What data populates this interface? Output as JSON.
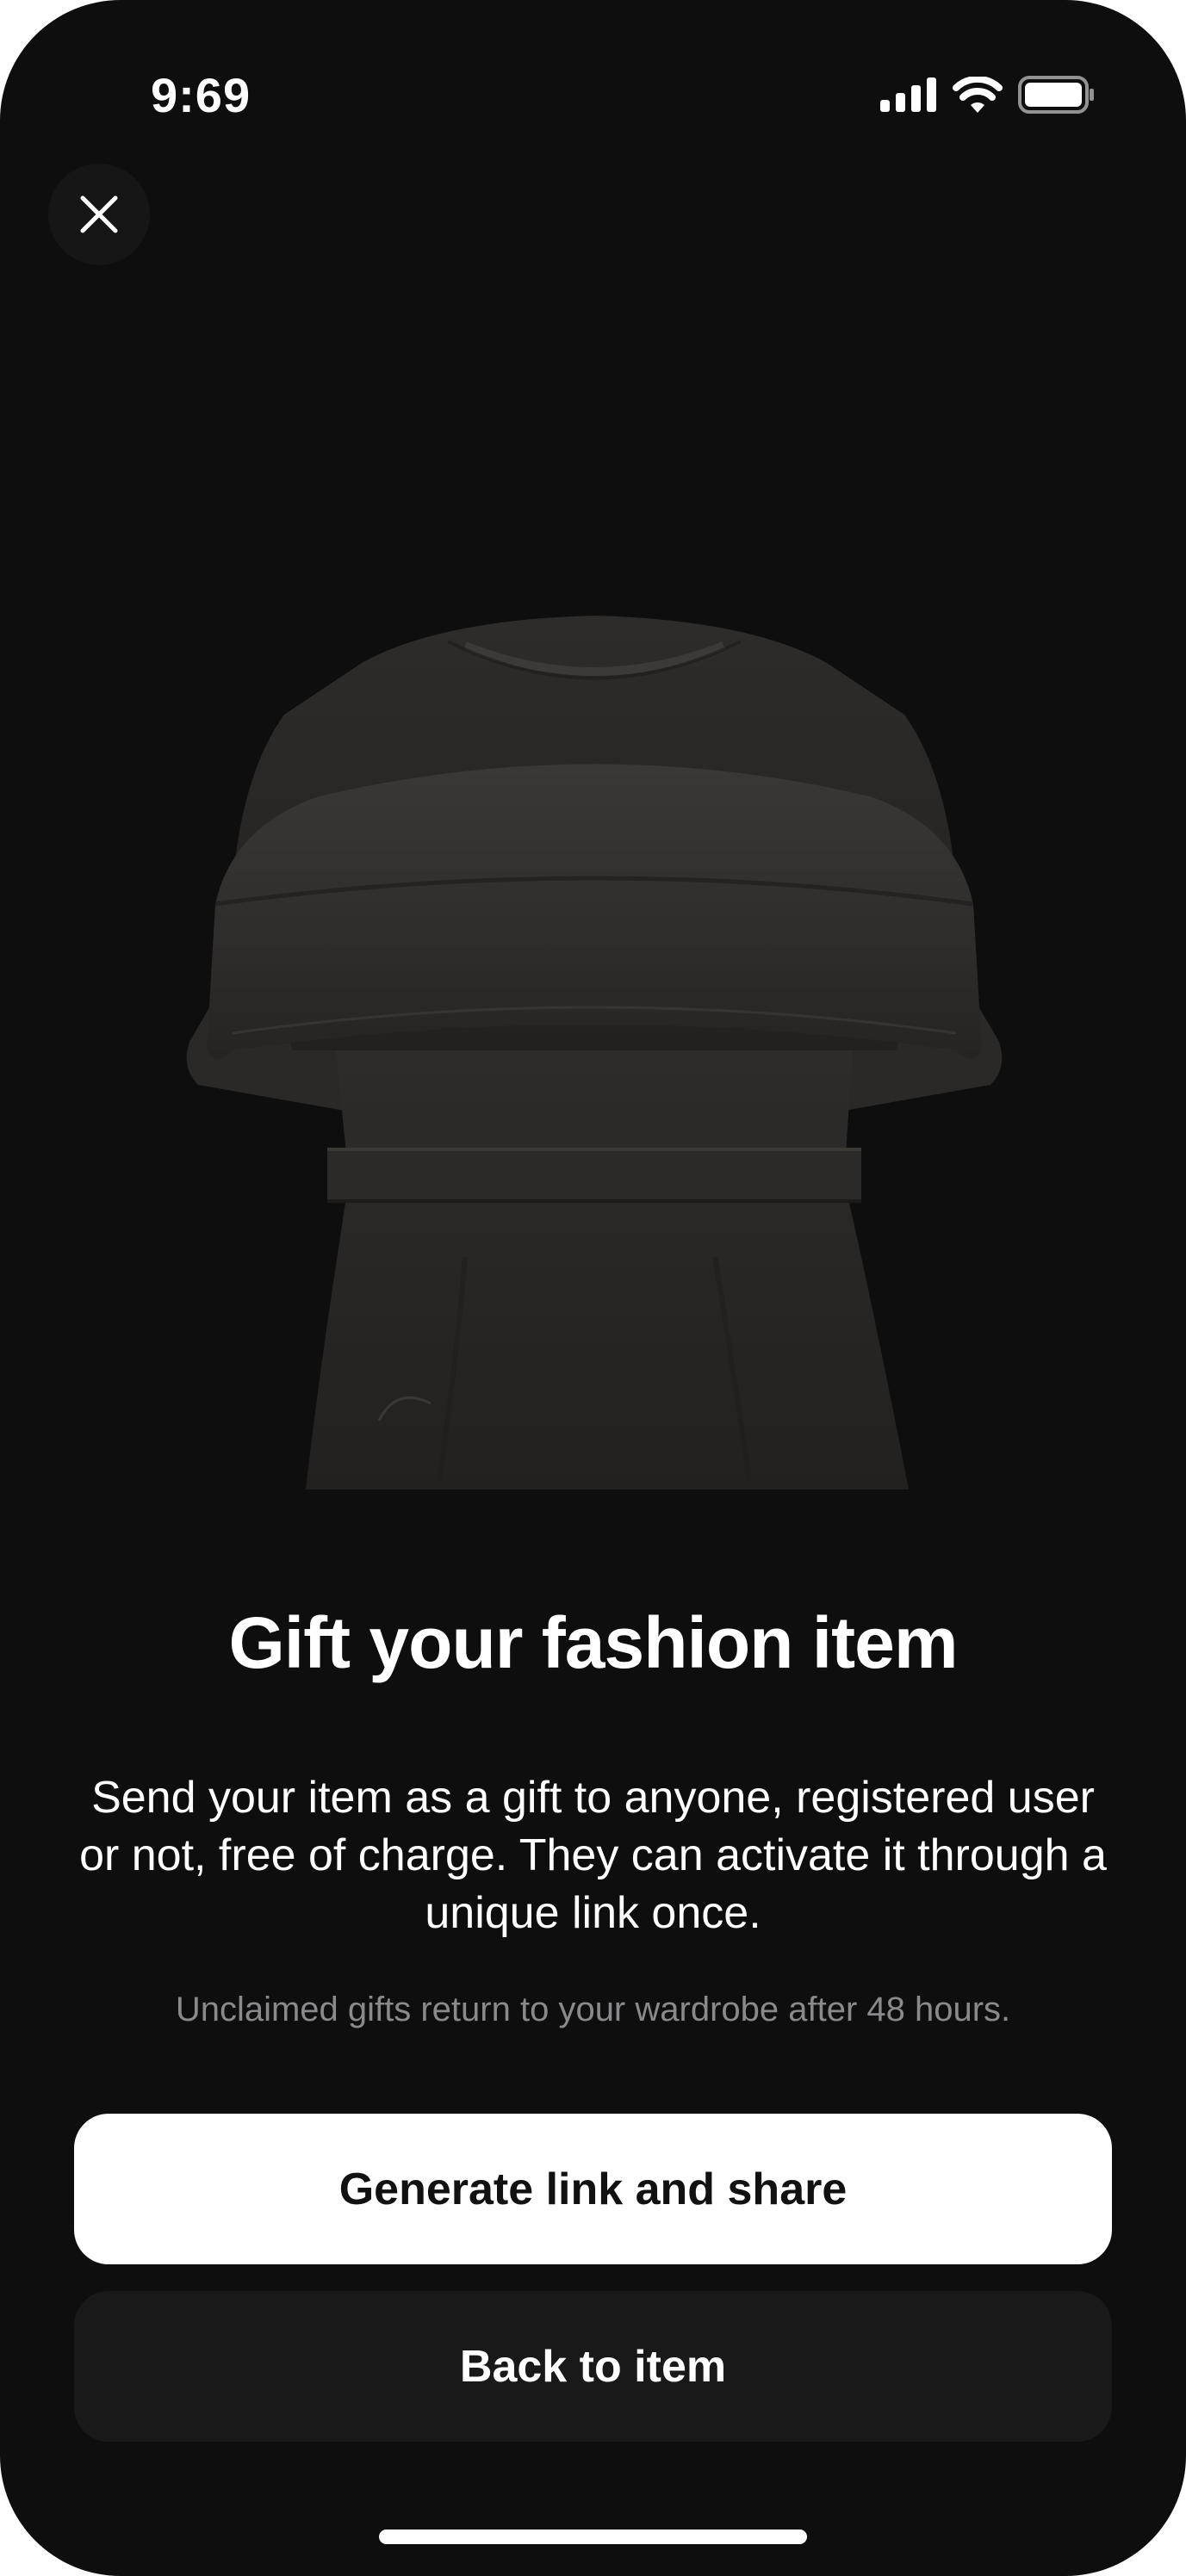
{
  "status_bar": {
    "time": "9:69",
    "icons": [
      "cellular-signal-icon",
      "wifi-icon",
      "battery-icon"
    ]
  },
  "header": {
    "close_icon": "close-icon"
  },
  "product": {
    "image": "garment-illustration"
  },
  "content": {
    "title": "Gift your fashion item",
    "description": "Send your item as a gift to anyone, registered user or not, free of charge. They can activate it through a unique link once.",
    "note": "Unclaimed gifts return to your wardrobe after 48 hours."
  },
  "actions": {
    "primary_label": "Generate link and share",
    "secondary_label": "Back to item"
  },
  "colors": {
    "background": "#0e0e0f",
    "primary_button": "#ffffff",
    "secondary_button": "#19191a",
    "muted_text": "#8a8a8c"
  }
}
